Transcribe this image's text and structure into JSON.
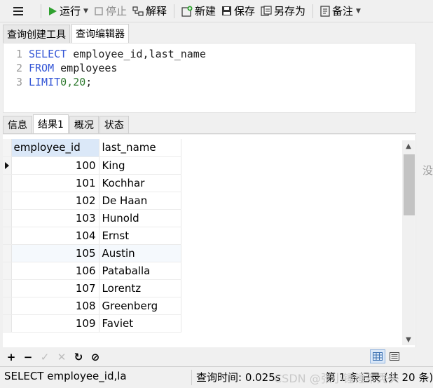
{
  "toolbar": {
    "run_label": "运行",
    "stop_label": "停止",
    "explain_label": "解释",
    "new_label": "新建",
    "save_label": "保存",
    "save_as_label": "另存为",
    "notes_label": "备注"
  },
  "top_tabs": [
    {
      "label": "查询创建工具"
    },
    {
      "label": "查询编辑器"
    }
  ],
  "editor": {
    "lines": [
      {
        "n": "1",
        "kw": "SELECT",
        "rest": " employee_id,last_name"
      },
      {
        "n": "2",
        "kw": "FROM",
        "rest": " employees"
      },
      {
        "n": "3",
        "kw": "LIMIT",
        "num": " 0,20",
        "rest": ";"
      }
    ]
  },
  "result_tabs": [
    {
      "label": "信息"
    },
    {
      "label": "结果1"
    },
    {
      "label": "概况"
    },
    {
      "label": "状态"
    }
  ],
  "grid": {
    "columns": [
      "employee_id",
      "last_name"
    ],
    "rows": [
      [
        "100",
        "King"
      ],
      [
        "101",
        "Kochhar"
      ],
      [
        "102",
        "De Haan"
      ],
      [
        "103",
        "Hunold"
      ],
      [
        "104",
        "Ernst"
      ],
      [
        "105",
        "Austin"
      ],
      [
        "106",
        "Pataballa"
      ],
      [
        "107",
        "Lorentz"
      ],
      [
        "108",
        "Greenberg"
      ],
      [
        "109",
        "Faviet"
      ]
    ]
  },
  "side_text": "没",
  "status": {
    "sql": "SELECT employee_id,la",
    "query_time": "查询时间: 0.025s",
    "watermark": "CSDN @张小锤锤不秃头",
    "records": "第 1 条记录 (共 20 条)"
  },
  "colors": {
    "keyword": "#3456d6",
    "number": "#2f7a2f",
    "run_green": "#2fa12f",
    "header_highlight": "#dbe8f8"
  }
}
